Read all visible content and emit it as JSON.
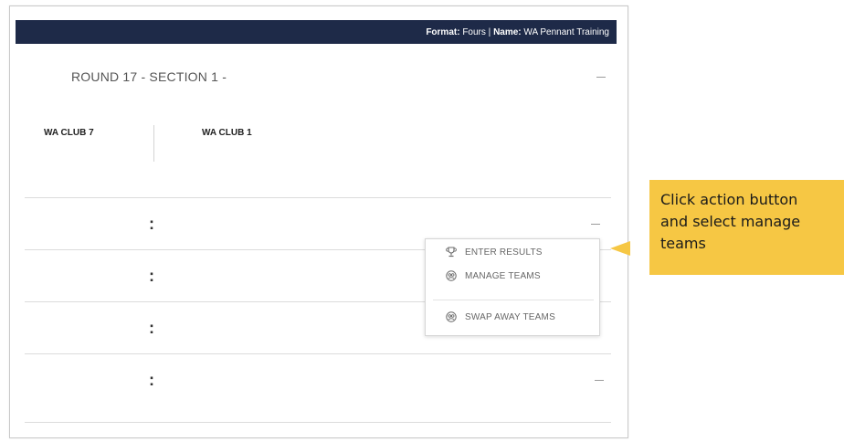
{
  "header": {
    "format_label": "Format:",
    "format_value": "Fours",
    "separator": "|",
    "name_label": "Name:",
    "name_value": "WA Pennant Training"
  },
  "round": {
    "title": "ROUND 17 - SECTION 1 -"
  },
  "teams": {
    "away": "WA CLUB 7",
    "home": "WA CLUB 1"
  },
  "rows": [
    {
      "action_glyph": ":"
    },
    {
      "action_glyph": ":"
    },
    {
      "action_glyph": ":"
    },
    {
      "action_glyph": ":"
    }
  ],
  "menu": {
    "items": [
      {
        "label": "ENTER RESULTS",
        "icon": "trophy-icon"
      },
      {
        "label": "MANAGE TEAMS",
        "icon": "team-circle-icon"
      },
      {
        "label": "SWAP AWAY TEAMS",
        "icon": "team-circle-icon"
      }
    ]
  },
  "callout": {
    "text_line1": "Click action button",
    "text_line2": "and select manage",
    "text_line3": "teams"
  },
  "colors": {
    "header_bg": "#1e2a48",
    "callout_bg": "#f6c744"
  }
}
